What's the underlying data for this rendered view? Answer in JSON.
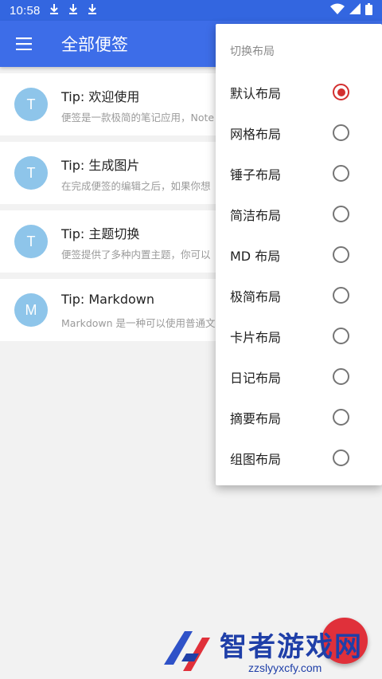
{
  "status_bar": {
    "time": "10:58",
    "icons": [
      "download-icon",
      "download-icon",
      "download-icon",
      "wifi-icon",
      "signal-icon",
      "battery-icon"
    ]
  },
  "app_bar": {
    "title": "全部便签",
    "menu_icon": "hamburger-menu-icon",
    "color": "#3d6de8"
  },
  "notes": [
    {
      "avatar": "T",
      "title": "Tip: 欢迎使用",
      "preview": "便签是一款极简的笔记应用，Note"
    },
    {
      "avatar": "T",
      "title": "Tip: 生成图片",
      "preview": "在完成便签的编辑之后，如果你想"
    },
    {
      "avatar": "T",
      "title": "Tip: 主题切换",
      "preview": "便签提供了多种内置主题，你可以"
    },
    {
      "avatar": "M",
      "title": "Tip: Markdown",
      "preview": "Markdown 是一种可以使用普通文本"
    }
  ],
  "layout_menu": {
    "header": "切换布局",
    "options": [
      {
        "label": "默认布局",
        "checked": true
      },
      {
        "label": "网格布局",
        "checked": false
      },
      {
        "label": "锤子布局",
        "checked": false
      },
      {
        "label": "简洁布局",
        "checked": false
      },
      {
        "label": "MD 布局",
        "checked": false
      },
      {
        "label": "极简布局",
        "checked": false
      },
      {
        "label": "卡片布局",
        "checked": false
      },
      {
        "label": "日记布局",
        "checked": false
      },
      {
        "label": "摘要布局",
        "checked": false
      },
      {
        "label": "组图布局",
        "checked": false
      }
    ],
    "accent": "#d32f2f"
  },
  "fab": {
    "color": "#e0303a"
  },
  "watermark": {
    "name": "智者游戏网",
    "url": "zzslyyxcfy.com"
  }
}
